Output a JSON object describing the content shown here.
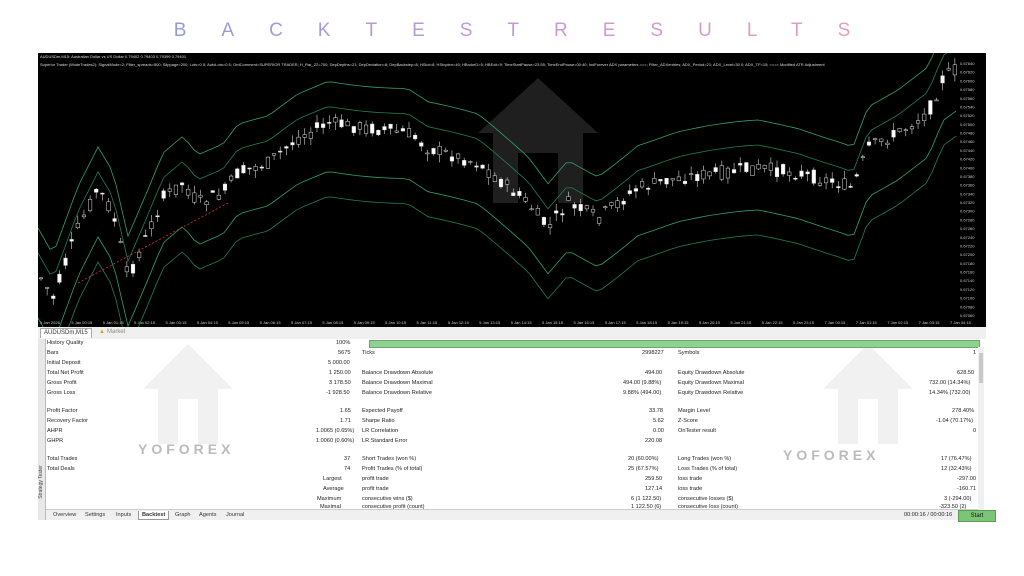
{
  "banner": {
    "title": "BACKTESTRESULTS"
  },
  "chart": {
    "header_line1": "AUDUSDm,M15: Australian Dollar vs US Dollar 0.79402 0.79403 0.79399 0.79401",
    "header_line2": "Superior Trader (ModeTrades2): SignalMode=2; Filter_spreads=500; Slippage=200; Lots=0.5; AutoLots=0.5; OrdComment=SUPERIOR TRADER; H_Rar_Z2=700; DepDepths=21; DepDeviation=8; DepBackstep=8; HSlot=8; HStoplen=40; HBrokeD=5; HBExit=9; TimeStartPause=23:55; TimeEndPause=00:40; IndForever ADX parameters ===; Filter_ADXentries; ADX_Period=21; ADX_Level=30.0; ADX_TF=15; ==== Modified ATR Adjustment",
    "price_labels": [
      "0.67640",
      "0.67620",
      "0.67600",
      "0.67580",
      "0.67560",
      "0.67540",
      "0.67520",
      "0.67500",
      "0.67480",
      "0.67460",
      "0.67440",
      "0.67420",
      "0.67400",
      "0.67380",
      "0.67360",
      "0.67340",
      "0.67320",
      "0.67300",
      "0.67280",
      "0.67260",
      "0.67240",
      "0.67220",
      "0.67200",
      "0.67180",
      "0.67160",
      "0.67140",
      "0.67120",
      "0.67100",
      "0.67080",
      "0.67060"
    ],
    "time_labels": [
      "5 Jan 2026",
      "5 Jan 00:15",
      "5 Jan 01:15",
      "5 Jan 02:15",
      "5 Jan 03:15",
      "5 Jan 04:15",
      "5 Jan 05:15",
      "5 Jan 06:15",
      "5 Jan 07:15",
      "5 Jan 08:15",
      "5 Jan 09:15",
      "5 Jan 10:15",
      "5 Jan 11:15",
      "5 Jan 12:15",
      "5 Jan 13:15",
      "5 Jan 14:15",
      "5 Jan 15:15",
      "5 Jan 16:15",
      "5 Jan 17:15",
      "5 Jan 18:15",
      "5 Jan 19:15",
      "5 Jan 20:15",
      "5 Jan 21:15",
      "5 Jan 22:15",
      "5 Jan 23:15",
      "7 Jan 00:15",
      "7 Jan 01:15",
      "7 Jan 02:15",
      "7 Jan 03:15",
      "7 Jan 04:15"
    ]
  },
  "chart_tabs": {
    "tab1": "AUDUSDm,M15",
    "tab2": "Market"
  },
  "tester": {
    "side_label": "Strategy Tester",
    "history_quality_label": "History Quality",
    "history_quality_value": "100%",
    "bars_label": "Bars",
    "bars_value": "5675",
    "ticks_label": "Ticks",
    "ticks_value": "2998227",
    "symbols_label": "Symbols",
    "symbols_value": "1",
    "initial_deposit_label": "Initial Deposit",
    "initial_deposit_value": "5 000.00",
    "total_net_profit_label": "Total Net Profit",
    "total_net_profit_value": "1 250.00",
    "gross_profit_label": "Gross Profit",
    "gross_profit_value": "3 178.50",
    "gross_loss_label": "Gross Loss",
    "gross_loss_value": "-1 928.50",
    "bda_label": "Balance Drawdown Absolute",
    "bda_value": "494.00",
    "bdm_label": "Balance Drawdown Maximal",
    "bdm_value": "494.00 (9.88%)",
    "bdr_label": "Balance Drawdown Relative",
    "bdr_value": "9.88% (494.00)",
    "eda_label": "Equity Drawdown Absolute",
    "eda_value": "628.50",
    "edm_label": "Equity Drawdown Maximal",
    "edm_value": "732.00 (14.34%)",
    "edr_label": "Equity Drawdown Relative",
    "edr_value": "14.34% (732.00)",
    "profit_factor_label": "Profit Factor",
    "profit_factor_value": "1.65",
    "recovery_factor_label": "Recovery Factor",
    "recovery_factor_value": "1.71",
    "ahpr_label": "AHPR",
    "ahpr_value": "1.0065 (0.65%)",
    "ghpr_label": "GHPR",
    "ghpr_value": "1.0060 (0.60%)",
    "expected_payoff_label": "Expected Payoff",
    "expected_payoff_value": "33.78",
    "sharpe_label": "Sharpe Ratio",
    "sharpe_value": "5.62",
    "lr_corr_label": "LR Correlation",
    "lr_corr_value": "0.00",
    "lr_std_label": "LR Standard Error",
    "lr_std_value": "220.08",
    "margin_level_label": "Margin Level",
    "margin_level_value": "278.40%",
    "zscore_label": "Z-Score",
    "zscore_value": "-1.04 (70.17%)",
    "ontester_label": "OnTester result",
    "ontester_value": "0",
    "total_trades_label": "Total Trades",
    "total_trades_value": "37",
    "total_deals_label": "Total Deals",
    "total_deals_value": "74",
    "short_trades_label": "Short Trades (won %)",
    "short_trades_value": "20 (60.00%)",
    "profit_trades_label": "Profit Trades (% of total)",
    "profit_trades_value": "25 (67.57%)",
    "long_trades_label": "Long Trades (won %)",
    "long_trades_value": "17 (76.47%)",
    "loss_trades_label": "Loss Trades (% of total)",
    "loss_trades_value": "12 (32.43%)",
    "largest_label": "Largest",
    "largest_profit_label": "profit trade",
    "largest_profit_value": "259.50",
    "largest_loss_label": "loss trade",
    "largest_loss_value": "-297.00",
    "average_label": "Average",
    "average_profit_label": "profit trade",
    "average_profit_value": "127.14",
    "average_loss_label": "loss trade",
    "average_loss_value": "-160.71",
    "maximum_label": "Maximum",
    "max_wins_label": "consecutive wins ($)",
    "max_wins_value": "6 (1 122.50)",
    "max_losses_label": "consecutive losses ($)",
    "max_losses_value": "3 (-294.00)",
    "maximal_label": "Maximal",
    "maximal_profit_label": "consecutive profit (count)",
    "maximal_profit_value": "1 122.50 (6)",
    "maximal_loss_label": "consecutive loss (count)",
    "maximal_loss_value": "-323.50 (2)"
  },
  "bottom_tabs": {
    "overview": "Overview",
    "settings": "Settings",
    "inputs": "Inputs",
    "backtest": "Backtest",
    "graph": "Graph",
    "agents": "Agents",
    "journal": "Journal"
  },
  "timer": "00:00:16 / 00:00:16",
  "start_label": "Start",
  "watermark": {
    "text": "YOFOREX"
  }
}
